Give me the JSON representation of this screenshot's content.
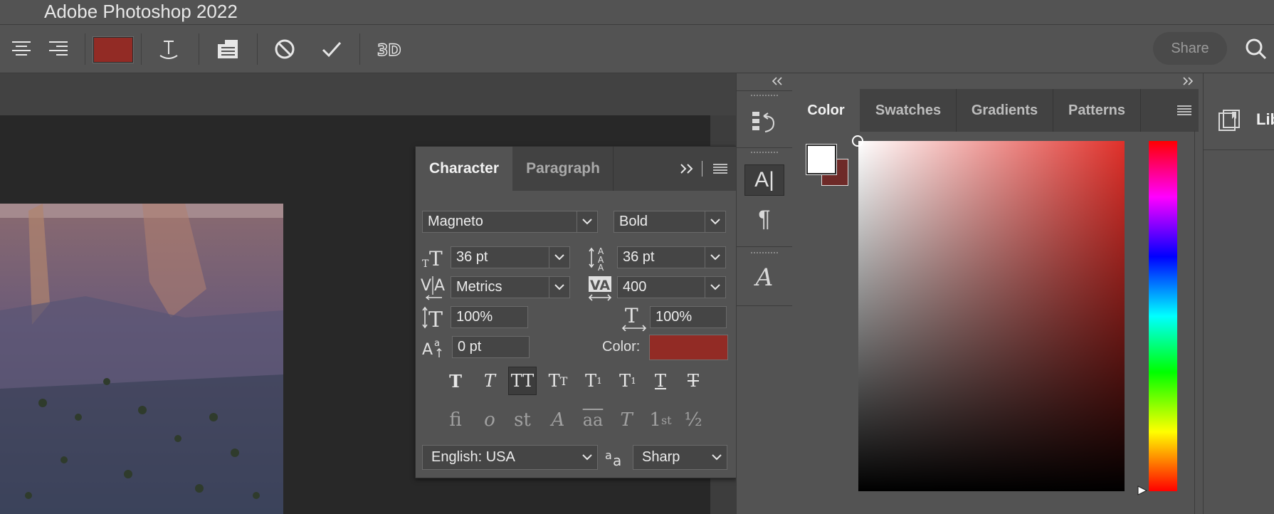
{
  "window": {
    "title": "Adobe Photoshop 2022"
  },
  "options_bar": {
    "text_color": "#922b25",
    "share_label": "Share"
  },
  "character_panel": {
    "tabs": [
      "Character",
      "Paragraph"
    ],
    "active_tab": "Character",
    "font_family": "Magneto",
    "font_style": "Bold",
    "font_size": "36 pt",
    "leading": "36 pt",
    "kerning": "Metrics",
    "tracking": "400",
    "vertical_scale": "100%",
    "horizontal_scale": "100%",
    "baseline_shift": "0 pt",
    "color_label": "Color:",
    "color_value": "#922b25",
    "language": "English: USA",
    "antialias": "Sharp",
    "style_buttons": [
      "faux-bold",
      "faux-italic",
      "all-caps",
      "small-caps",
      "superscript",
      "subscript",
      "underline",
      "strikethrough"
    ],
    "active_style": "all-caps",
    "opentype_buttons": [
      "fi",
      "ordinal",
      "st",
      "swash",
      "aa",
      "titling",
      "1st",
      "½"
    ]
  },
  "color_panel": {
    "tabs": [
      "Color",
      "Swatches",
      "Gradients",
      "Patterns"
    ],
    "active_tab": "Color",
    "foreground": "#ffffff",
    "background": "#6e2a28",
    "hue_color": "#e0302a"
  },
  "libraries_panel": {
    "label": "Lib"
  }
}
